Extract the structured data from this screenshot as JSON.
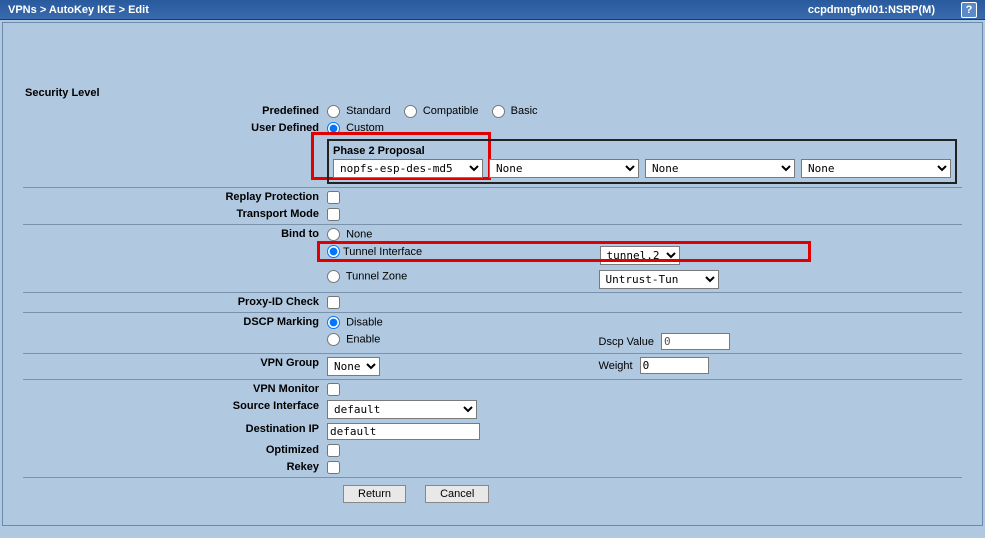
{
  "header": {
    "breadcrumb_parts": [
      "VPNs",
      "AutoKey IKE",
      "Edit"
    ],
    "sep": ">",
    "device": "ccpdmngfwl01:NSRP(M)",
    "help": "?"
  },
  "section": {
    "security_level": "Security Level"
  },
  "labels": {
    "predefined": "Predefined",
    "standard": "Standard",
    "compatible": "Compatible",
    "basic": "Basic",
    "user_defined": "User Defined",
    "custom": "Custom",
    "phase2": "Phase 2 Proposal",
    "replay": "Replay Protection",
    "transport": "Transport Mode",
    "bindto": "Bind to",
    "bind_none": "None",
    "tunnel_if": "Tunnel Interface",
    "tunnel_zone": "Tunnel Zone",
    "proxyid": "Proxy-ID Check",
    "dscp": "DSCP Marking",
    "disable": "Disable",
    "enable": "Enable",
    "dscpval": "Dscp Value",
    "vpngroup": "VPN Group",
    "weight": "Weight",
    "vpnmon": "VPN Monitor",
    "srcif": "Source Interface",
    "dstip": "Destination IP",
    "optimized": "Optimized",
    "rekey": "Rekey"
  },
  "values": {
    "phase2_sel1": "nopfs-esp-des-md5",
    "phase2_none": "None",
    "tunnel_if_sel": "tunnel.2",
    "tunnel_zone_sel": "Untrust-Tun",
    "vpngroup_sel": "None",
    "dscpval": "0",
    "weight": "0",
    "srcif_sel": "default",
    "dstip": "default"
  },
  "buttons": {
    "return": "Return",
    "cancel": "Cancel"
  }
}
